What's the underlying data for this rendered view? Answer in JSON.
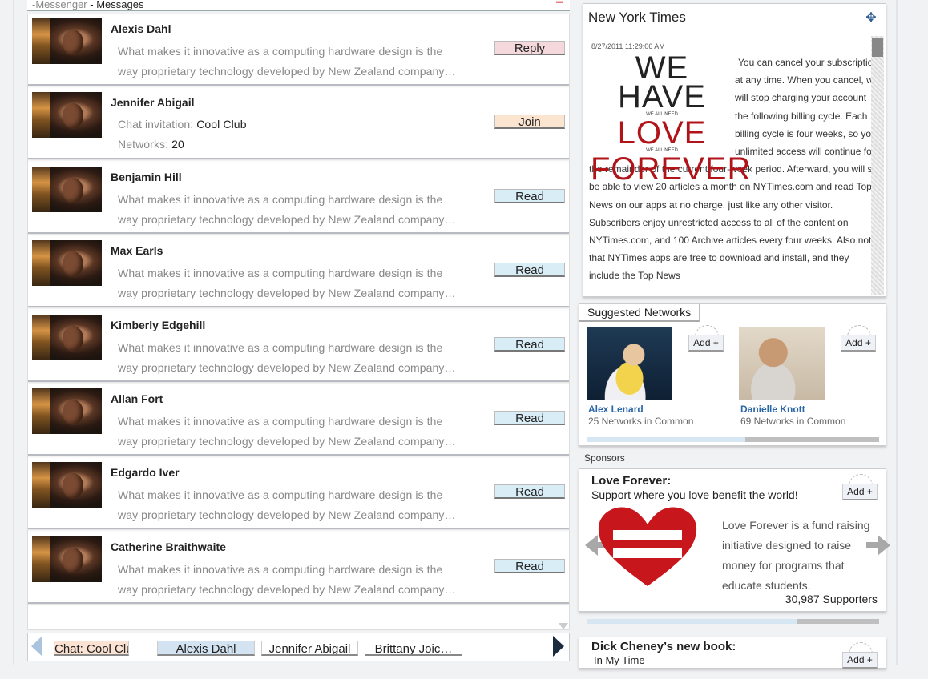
{
  "messenger": {
    "header_prefix": "-Messenger",
    "header_sep": " - ",
    "header_title": "Messages",
    "collapse_symbol": "−",
    "messages": [
      {
        "name": "Alexis Dahl",
        "kind": "message",
        "line1": "What makes it innovative as a computing hardware design is the",
        "line2": "way proprietary technology developed by New Zealand company…",
        "action": "Reply"
      },
      {
        "name": "Jennifer Abigail",
        "kind": "invite",
        "invite_label": "Chat invitation: ",
        "invite_value": "Cool Club",
        "networks_label": "Networks: ",
        "networks_value": "20",
        "action": "Join"
      },
      {
        "name": "Benjamin Hill",
        "kind": "message",
        "line1": "What makes it innovative as a computing hardware design is the",
        "line2": "way proprietary technology developed by New Zealand company…",
        "action": "Read"
      },
      {
        "name": "Max Earls",
        "kind": "message",
        "line1": "What makes it innovative as a computing hardware design is the",
        "line2": "way proprietary technology developed by New Zealand company…",
        "action": "Read"
      },
      {
        "name": "Kimberly Edgehill",
        "kind": "message",
        "line1": "What makes it innovative as a computing hardware design is the",
        "line2": "way proprietary technology developed by New Zealand company…",
        "action": "Read"
      },
      {
        "name": "Allan Fort",
        "kind": "message",
        "line1": "What makes it innovative as a computing hardware design is the",
        "line2": "way proprietary technology developed by New Zealand company…",
        "action": "Read"
      },
      {
        "name": "Edgardo Iver",
        "kind": "message",
        "line1": "What makes it innovative as a computing hardware design is the",
        "line2": "way proprietary technology developed by New Zealand company…",
        "action": "Read"
      },
      {
        "name": "Catherine Braithwaite",
        "kind": "message",
        "line1": "What makes it innovative as a computing hardware design is the",
        "line2": "way proprietary technology developed by New Zealand company…",
        "action": "Read"
      }
    ],
    "tabs": [
      "Chat: Cool Club",
      "Alexis Dahl",
      "Jennifer Abigail",
      "Brittany Joic…"
    ]
  },
  "nyt": {
    "title": "New York Times",
    "date": "8/27/2011 11:29:06 AM",
    "poster": {
      "line1": "WE HAVE",
      "small": "WE ALL NEED",
      "line2": "LOVE",
      "small2": "WE ALL NEED",
      "line3": "FOREVER"
    },
    "body": "You can cancel your subscription at any time. When you cancel, we will stop charging your account the following billing cycle. Each billing cycle is four weeks, so your unlimited access will continue for the remainder of the current four-week period. Afterward, you will still be able to view 20 articles a month on NYTimes.com and read Top News on our apps at no charge, just like any other visitor. Subscribers enjoy unrestricted access to all of the content on NYTimes.com, and 100 Archive articles every four weeks. Also note that NYTimes apps are free to download and install, and they include the Top News"
  },
  "suggested": {
    "title": "Suggested Networks",
    "add_label": "Add +",
    "progress": 0.46,
    "people": [
      {
        "name": "Alex Lenard",
        "networks": "25 Networks  in Common"
      },
      {
        "name": "Danielle Knott",
        "networks": "69 Networks  in Common"
      }
    ]
  },
  "sponsors": {
    "label": "Sponsors",
    "title": "Love Forever:",
    "subtitle": "Support where you love benefit the world!",
    "add_label": "Add +",
    "description": "Love Forever is a fund raising initiative designed to raise money for programs that educate students.",
    "supporters": "30,987 Supporters",
    "progress": 0.28,
    "heart_color": "#c8161d"
  },
  "book": {
    "title": "Dick Cheney’s new book:",
    "subtitle": "In My Time",
    "add_label": "Add +"
  }
}
